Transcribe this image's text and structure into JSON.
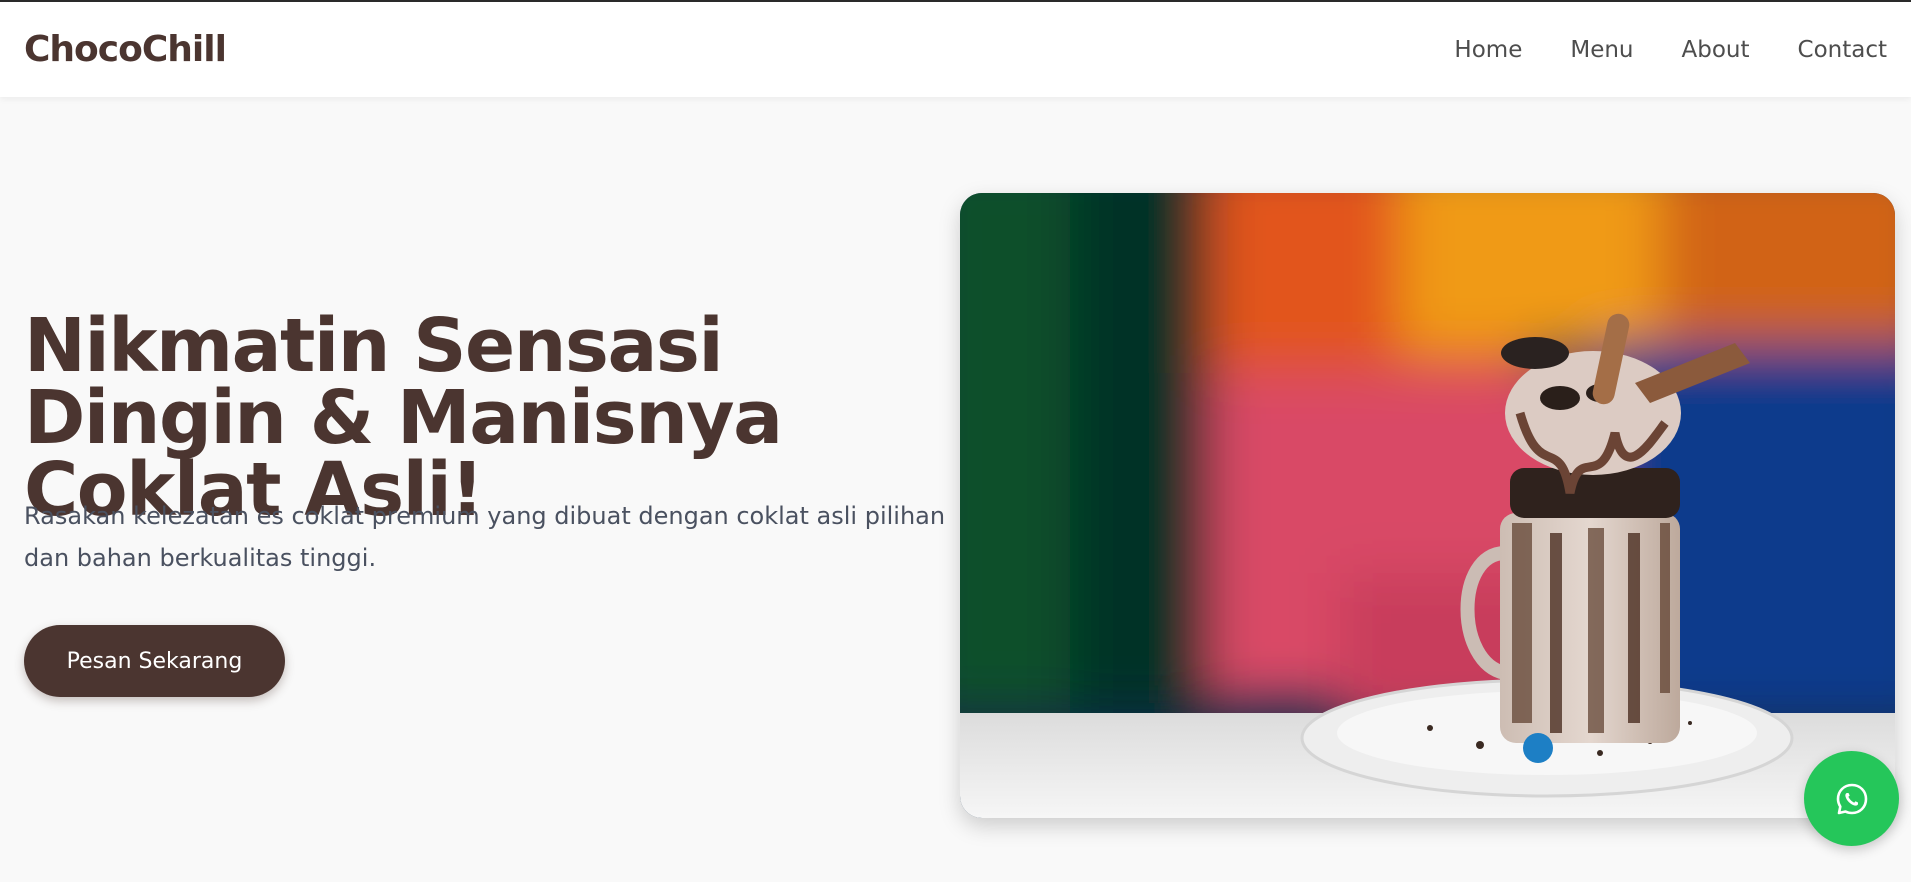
{
  "brand": {
    "name": "ChocoChill"
  },
  "nav": {
    "home": "Home",
    "menu": "Menu",
    "about": "About",
    "contact": "Contact"
  },
  "hero": {
    "title": "Nikmatin Sensasi Dingin & Manisnya Coklat Asli!",
    "subtitle": "Rasakan kelezatan es coklat premium yang dibuat dengan coklat asli pilihan dan bahan berkualitas tinggi.",
    "cta_label": "Pesan Sekarang",
    "image_subject": "chocolate-freakshake-photo"
  },
  "floating": {
    "icon": "whatsapp-icon"
  },
  "colors": {
    "brand": "#4b3530",
    "background": "#f9f9f9",
    "whatsapp": "#25c65a",
    "subtitle": "#4a5160"
  }
}
